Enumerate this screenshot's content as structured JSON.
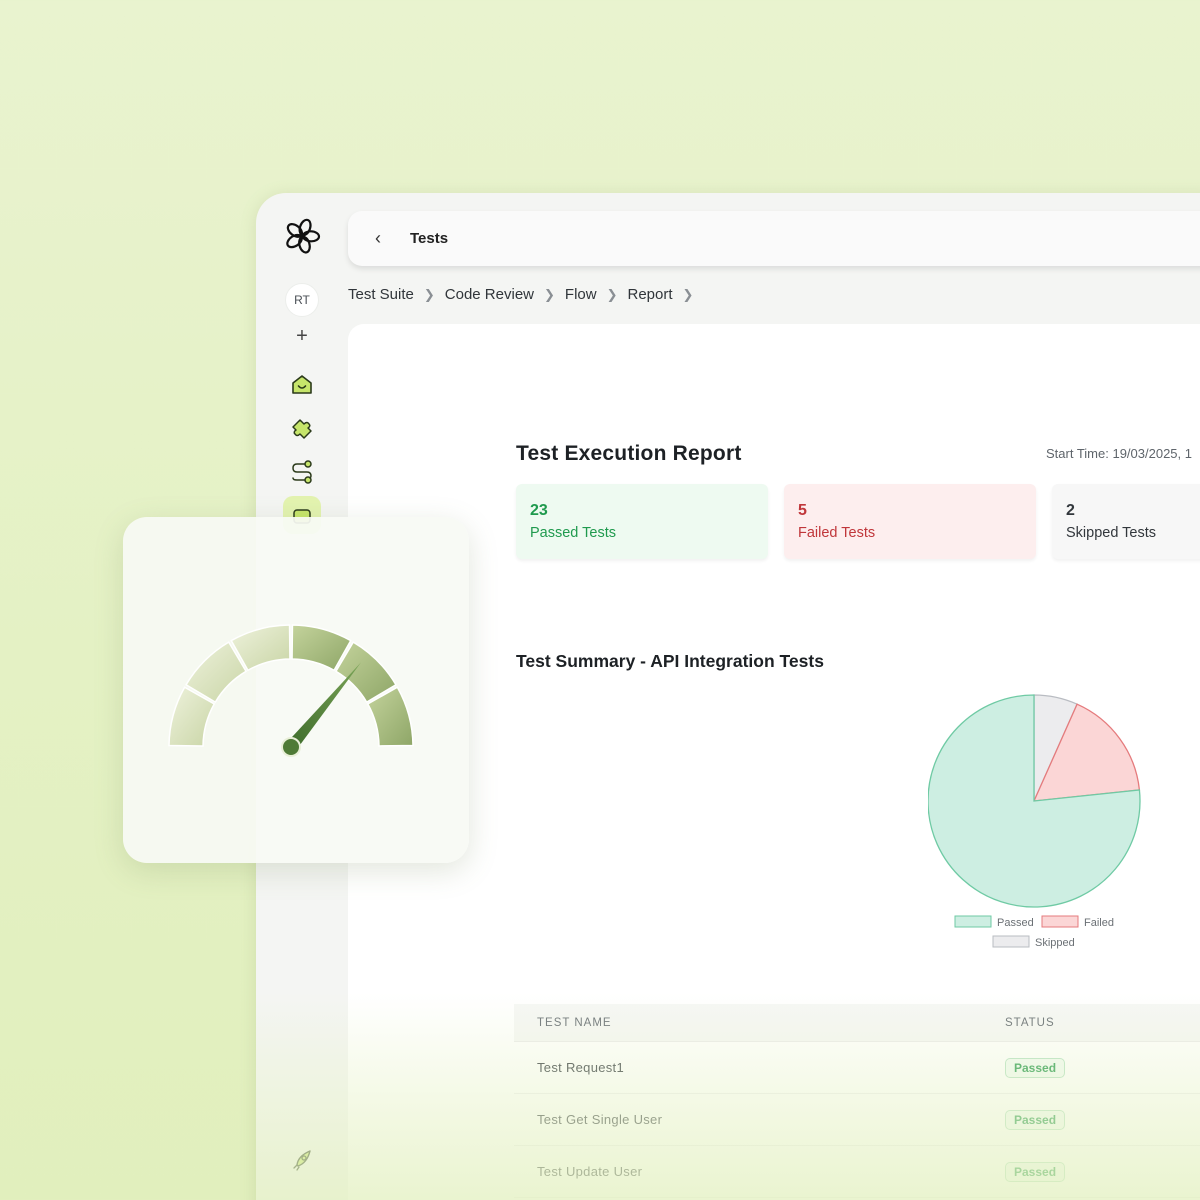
{
  "sidebar": {
    "avatar_initials": "RT",
    "add_symbol": "+",
    "items": [
      {
        "name": "home",
        "icon": "home-icon"
      },
      {
        "name": "integrations",
        "icon": "puzzle-icon"
      },
      {
        "name": "flow",
        "icon": "flow-icon"
      },
      {
        "name": "reports",
        "icon": "report-icon",
        "active": true
      },
      {
        "name": "deploy",
        "icon": "rocket-icon"
      }
    ]
  },
  "header": {
    "back_symbol": "‹",
    "title": "Tests"
  },
  "breadcrumb": [
    "Test Suite",
    "Code Review",
    "Flow",
    "Report"
  ],
  "report": {
    "title": "Test Execution Report",
    "start_time": "Start Time: 19/03/2025, 1",
    "cards": {
      "passed": {
        "count": "23",
        "label": "Passed Tests"
      },
      "failed": {
        "count": "5",
        "label": "Failed Tests"
      },
      "skipped": {
        "count": "2",
        "label": "Skipped Tests"
      }
    },
    "summary_title": "Test Summary - API Integration Tests"
  },
  "chart_data": {
    "type": "pie",
    "labels": [
      "Passed",
      "Failed",
      "Skipped"
    ],
    "values": [
      23,
      5,
      2
    ],
    "colors": [
      "#cdeee2",
      "#fbd6d6",
      "#ececee"
    ],
    "stroke_colors": [
      "#6fcaa4",
      "#e57b7d",
      "#b9bcc2"
    ],
    "legend": "bottom"
  },
  "table": {
    "headers": {
      "name": "TEST NAME",
      "status": "STATUS"
    },
    "rows": [
      {
        "name": "Test Request1",
        "status": "Passed"
      },
      {
        "name": "Test Get Single User",
        "status": "Passed"
      },
      {
        "name": "Test Update User",
        "status": "Passed"
      }
    ]
  },
  "gauge": {
    "icon": "speedometer-icon",
    "level": 0.72
  }
}
